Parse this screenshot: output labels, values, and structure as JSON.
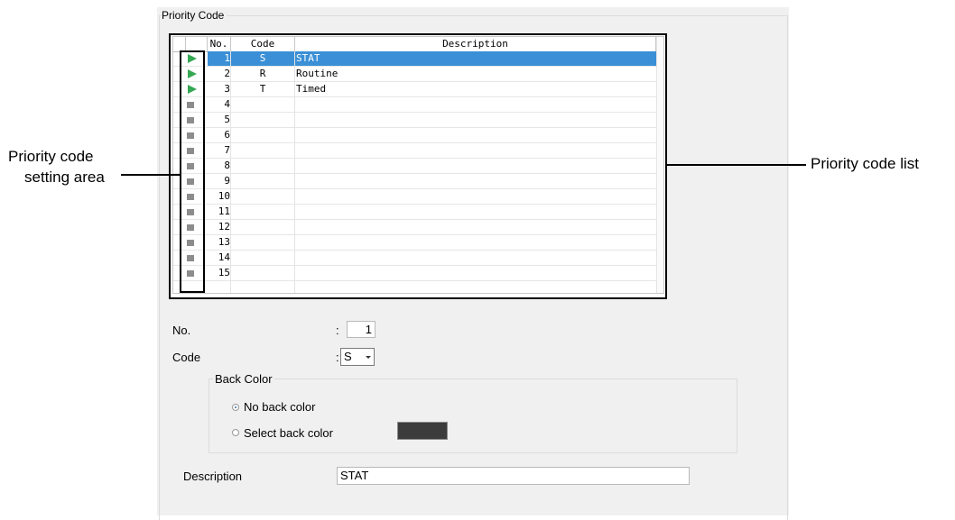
{
  "group": {
    "title": "Priority Code"
  },
  "list": {
    "columns": [
      "No.",
      "Code",
      "Description"
    ],
    "rows": [
      {
        "no": "1",
        "code": "S",
        "desc": "STAT",
        "indicator": "play-icon",
        "selected": true
      },
      {
        "no": "2",
        "code": "R",
        "desc": "Routine",
        "indicator": "play-icon"
      },
      {
        "no": "3",
        "code": "T",
        "desc": "Timed",
        "indicator": "play-icon"
      },
      {
        "no": "4",
        "code": "",
        "desc": "",
        "indicator": "square-icon"
      },
      {
        "no": "5",
        "code": "",
        "desc": "",
        "indicator": "square-icon"
      },
      {
        "no": "6",
        "code": "",
        "desc": "",
        "indicator": "square-icon"
      },
      {
        "no": "7",
        "code": "",
        "desc": "",
        "indicator": "square-icon"
      },
      {
        "no": "8",
        "code": "",
        "desc": "",
        "indicator": "square-icon"
      },
      {
        "no": "9",
        "code": "",
        "desc": "",
        "indicator": "square-icon"
      },
      {
        "no": "10",
        "code": "",
        "desc": "",
        "indicator": "square-icon"
      },
      {
        "no": "11",
        "code": "",
        "desc": "",
        "indicator": "square-icon"
      },
      {
        "no": "12",
        "code": "",
        "desc": "",
        "indicator": "square-icon"
      },
      {
        "no": "13",
        "code": "",
        "desc": "",
        "indicator": "square-icon"
      },
      {
        "no": "14",
        "code": "",
        "desc": "",
        "indicator": "square-icon"
      },
      {
        "no": "15",
        "code": "",
        "desc": "",
        "indicator": "square-icon"
      }
    ]
  },
  "callouts": {
    "left_line1": "Priority code",
    "left_line2": "setting area",
    "right": "Priority code list"
  },
  "form": {
    "no_label": "No.",
    "no_value": "1",
    "code_label": "Code",
    "code_value": "S",
    "colon": ":",
    "back_color": {
      "title": "Back Color",
      "option_none": "No back color",
      "option_select": "Select back color",
      "selected": "No back color",
      "swatch_color": "#3c3c3c"
    },
    "description_label": "Description",
    "description_value": "STAT"
  },
  "colors": {
    "selection": "#3a8fd6",
    "indicator_active": "#34a853",
    "indicator_inactive": "#8c8c8c"
  }
}
